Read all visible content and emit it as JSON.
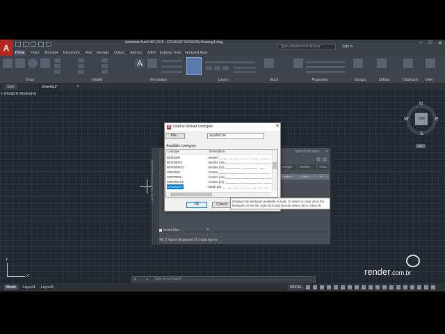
{
  "window": {
    "title": "Autodesk AutoCAD 2018 - STUDENT VERSION    Drawing1.dwg",
    "search_placeholder": "Type a keyword or phrase",
    "sign_in": "Sign In",
    "app_letter": "A"
  },
  "menu_tabs": [
    "Home",
    "Insert",
    "Annotate",
    "Parametric",
    "View",
    "Manage",
    "Output",
    "Add-ins",
    "A360",
    "Express Tools",
    "Featured Apps"
  ],
  "ribbon_panels": [
    "Draw",
    "Modify",
    "Annotation",
    "Layers",
    "Block",
    "Properties",
    "Groups",
    "Utilities",
    "Clipboard",
    "View"
  ],
  "doc_tabs": [
    "Start",
    "Drawing1*"
  ],
  "viewport_label": "[–][Top][2D Wireframe]",
  "viewcube": {
    "n": "N",
    "s": "S",
    "e": "E",
    "w": "W",
    "top": "TOP",
    "wcs": "WCS"
  },
  "ucs": {
    "x": "X",
    "y": "Y"
  },
  "command_line_placeholder": "Type a command",
  "status_tabs": [
    "Model",
    "Layout1",
    "Layout2"
  ],
  "status_model": "MODEL",
  "layer_manager": {
    "side_title": "LAYER PROPERTIES MANAGER",
    "search_placeholder": "Search for layer",
    "columns": [
      "Linetype",
      "Linewei...",
      "Trans..."
    ],
    "row": [
      "Continu...",
      "— Defa...",
      "0"
    ],
    "invert_filter": "Invert filter",
    "footer": "All: 2 layers displayed of 2 total layers",
    "collapse": "«"
  },
  "dialog": {
    "title": "Load or Reload Linetypes",
    "file_button": "File...",
    "file_value": "acadiso.lin",
    "available_label": "Available Linetypes",
    "col_linetype": "Linetype",
    "col_description": "Description",
    "rows": [
      {
        "linetype": "BORDER",
        "description": "Border __ __ . __ __ . __ __ . __ __ . __ __ ."
      },
      {
        "linetype": "BORDER2",
        "description": "Border (.5x) __.__.__.__.__.__.__.__.__.__.__."
      },
      {
        "linetype": "BORDERX2",
        "description": "Border (2x) ____ ____ . ____ ____ . ___"
      },
      {
        "linetype": "CENTER",
        "description": "Center ____ _ ____ _ ____ _ ____ _ ____ _ ____"
      },
      {
        "linetype": "CENTER2",
        "description": "Center (.5x) ___ _ ___ _ ___ _ ___ _ ___ _ ___"
      },
      {
        "linetype": "CENTERX2",
        "description": "Center (2x) ________ __ ________ __ _____"
      },
      {
        "linetype": "DASHDOT",
        "description": "Dash dot __ . __ . __ . __ . __ . __ . __ . __"
      }
    ],
    "selected_index": 6,
    "ok": "OK",
    "cancel": "Cancel",
    "tooltip": "Displays the linetypes available to load. To select or clear all of the linetypes on the list, right-click and choose Select All or Clear All."
  },
  "watermark": {
    "main": "render",
    "suffix": ".com.br"
  }
}
